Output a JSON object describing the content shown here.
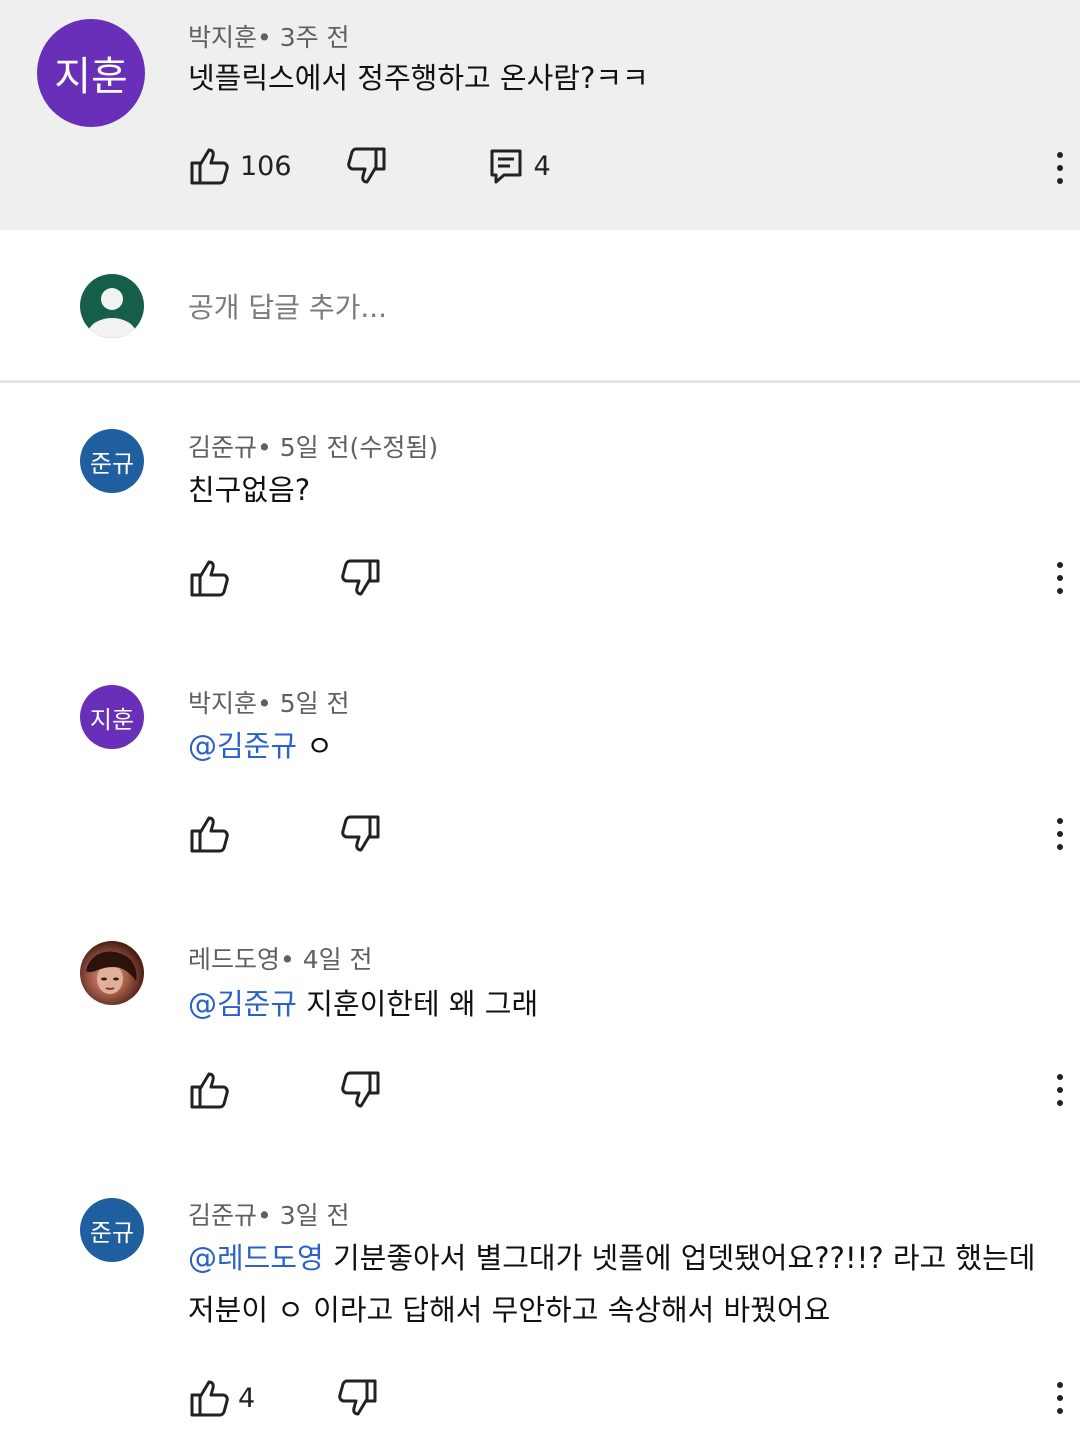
{
  "top_comment": {
    "avatar_text": "지훈",
    "author": "박지훈",
    "time": "• 3주 전",
    "text": "넷플릭스에서 정주행하고 온사람?ㅋㅋ",
    "likes": "106",
    "replies": "4"
  },
  "reply_box": {
    "placeholder": "공개 답글 추가..."
  },
  "replies": [
    {
      "avatar_text": "준규",
      "author": "김준규",
      "time": "• 5일 전(수정됨)",
      "text": "친구없음?"
    },
    {
      "avatar_text": "지훈",
      "author": "박지훈",
      "time": "• 5일 전",
      "mention": "@김준규",
      "text": "ㅇ"
    },
    {
      "author": "레드도영",
      "time": "• 4일 전",
      "mention": "@김준규",
      "text": "지훈이한테 왜 그래"
    },
    {
      "avatar_text": "준규",
      "author": "김준규",
      "time": "• 3일 전",
      "mention": "@레드도영",
      "text": "기분좋아서 별그대가 넷플에 업뎃됐어요??!!? 라고 했는데",
      "text2": "저분이 ㅇ 이라고 답해서 무안하고 속상해서 바꿨어요",
      "likes": "4"
    }
  ],
  "colors": {
    "mention": "#2a62c9",
    "avatar_purple": "#6a2fb8",
    "avatar_blue": "#1f5f9f",
    "highlight_bg": "#efefef"
  }
}
